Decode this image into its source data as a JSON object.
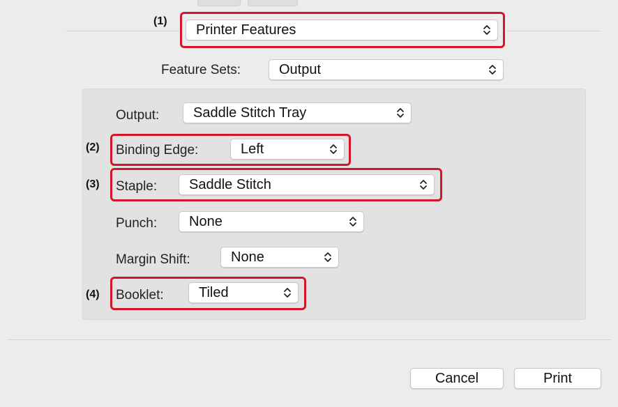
{
  "panel_selector": {
    "value": "Printer Features",
    "marker": "(1)"
  },
  "feature_sets": {
    "label": "Feature Sets:",
    "value": "Output"
  },
  "fields": {
    "output": {
      "label": "Output:",
      "value": "Saddle Stitch Tray"
    },
    "binding_edge": {
      "label": "Binding Edge:",
      "value": "Left",
      "marker": "(2)"
    },
    "staple": {
      "label": "Staple:",
      "value": "Saddle Stitch",
      "marker": "(3)"
    },
    "punch": {
      "label": "Punch:",
      "value": "None"
    },
    "margin_shift": {
      "label": "Margin Shift:",
      "value": "None"
    },
    "booklet": {
      "label": "Booklet:",
      "value": "Tiled",
      "marker": "(4)"
    }
  },
  "buttons": {
    "cancel": "Cancel",
    "print": "Print"
  },
  "icons": {
    "popup_chevron": "chevron-updown-icon"
  },
  "colors": {
    "highlight": "#d3172b",
    "background": "#ececec",
    "panel": "#e2e2e2"
  }
}
